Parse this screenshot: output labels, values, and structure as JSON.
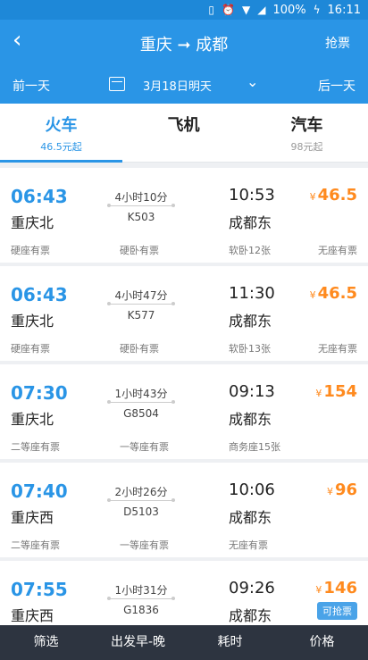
{
  "status_bar": {
    "battery": "100%",
    "time": "16:11",
    "icons": [
      "vibrate-icon",
      "alarm-icon",
      "wifi-icon",
      "signal-icon",
      "charging-icon"
    ]
  },
  "header": {
    "back_icon": "back-chevron-icon",
    "title": "重庆 ➞ 成都",
    "grab_label": "抢票"
  },
  "date_bar": {
    "prev_label": "前一天",
    "date_label": "3月18日明天",
    "next_label": "后一天",
    "calendar_icon": "calendar-icon",
    "dropdown_icon": "chevron-down-icon"
  },
  "tabs": [
    {
      "label": "火车",
      "sub": "46.5元起"
    },
    {
      "label": "飞机",
      "sub": ""
    },
    {
      "label": "汽车",
      "sub": "98元起"
    }
  ],
  "trains": [
    {
      "dep_time": "06:43",
      "dep_station": "重庆北",
      "duration": "4小时10分",
      "train_no": "K503",
      "arr_time": "10:53",
      "arr_station": "成都东",
      "price": "46.5",
      "yen": "¥",
      "seats": [
        "硬座有票",
        "硬卧有票",
        "软卧12张",
        "无座有票"
      ],
      "badge": ""
    },
    {
      "dep_time": "06:43",
      "dep_station": "重庆北",
      "duration": "4小时47分",
      "train_no": "K577",
      "arr_time": "11:30",
      "arr_station": "成都东",
      "price": "46.5",
      "yen": "¥",
      "seats": [
        "硬座有票",
        "硬卧有票",
        "软卧13张",
        "无座有票"
      ],
      "badge": ""
    },
    {
      "dep_time": "07:30",
      "dep_station": "重庆北",
      "duration": "1小时43分",
      "train_no": "G8504",
      "arr_time": "09:13",
      "arr_station": "成都东",
      "price": "154",
      "yen": "¥",
      "seats": [
        "二等座有票",
        "一等座有票",
        "商务座15张",
        ""
      ],
      "badge": ""
    },
    {
      "dep_time": "07:40",
      "dep_station": "重庆西",
      "duration": "2小时26分",
      "train_no": "D5103",
      "arr_time": "10:06",
      "arr_station": "成都东",
      "price": "96",
      "yen": "¥",
      "seats": [
        "二等座有票",
        "一等座有票",
        "无座有票",
        ""
      ],
      "badge": ""
    },
    {
      "dep_time": "07:55",
      "dep_station": "重庆西",
      "duration": "1小时31分",
      "train_no": "G1836",
      "arr_time": "09:26",
      "arr_station": "成都东",
      "price": "146",
      "yen": "¥",
      "seats": [
        "",
        "",
        "",
        ""
      ],
      "badge": "可抢票"
    }
  ],
  "bottom_bar": {
    "filter": "筛选",
    "depart": "出发早-晚",
    "duration": "耗时",
    "price": "价格"
  },
  "colors": {
    "primary": "#2a95e6",
    "price": "#ff8a1e",
    "bottom": "#2d3440"
  }
}
